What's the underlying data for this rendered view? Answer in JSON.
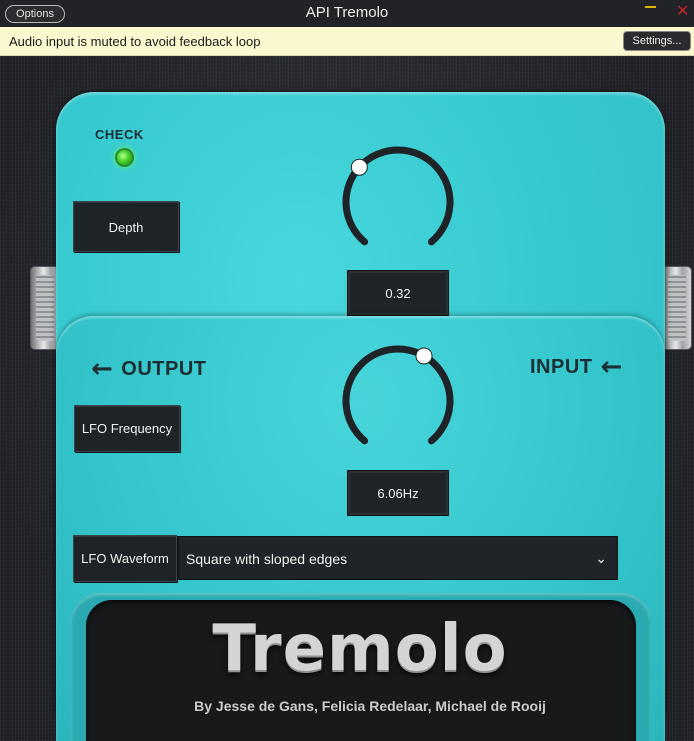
{
  "window": {
    "title": "API Tremolo",
    "options_label": "Options",
    "minimize_glyph": "–",
    "close_glyph": "✕"
  },
  "notice": {
    "text": "Audio input is muted to avoid feedback loop",
    "settings_label": "Settings..."
  },
  "pedal": {
    "check_label": "CHECK",
    "led_color": "#43d22a",
    "body_color": "#35c9cf",
    "depth": {
      "label": "Depth",
      "value": "0.32",
      "level": 0.32
    },
    "lfo_frequency": {
      "label": "LFO Frequency",
      "value": "6.06Hz"
    },
    "output_label": "OUTPUT",
    "input_label": "INPUT",
    "arrow_glyph": "←",
    "lfo_waveform": {
      "label": "LFO Waveform",
      "selected": "Square with sloped edges",
      "chevron": "⌄"
    },
    "brand": "Tremolo",
    "credits": "By Jesse de Gans, Felicia Redelaar, Michael de Rooij"
  }
}
